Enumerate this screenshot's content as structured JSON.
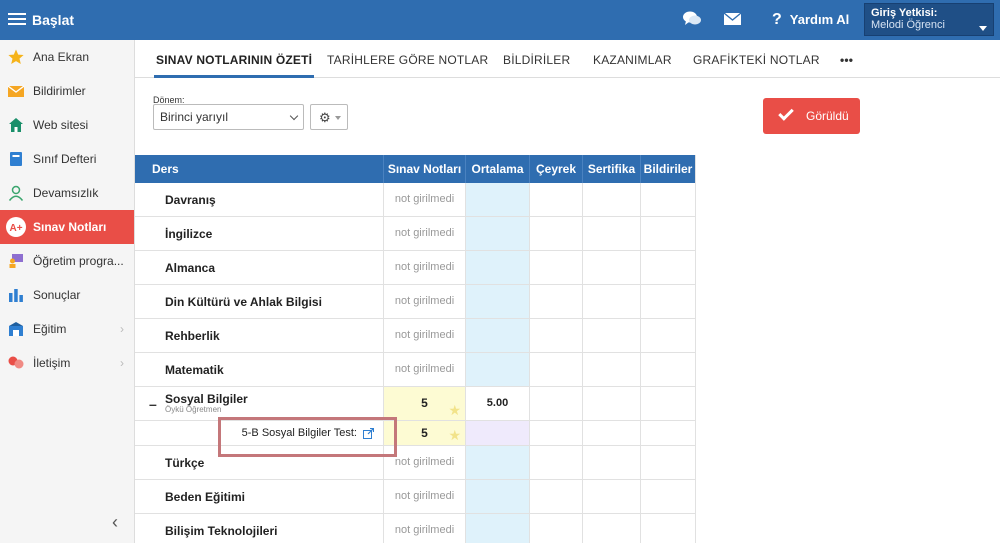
{
  "topbar": {
    "title": "Başlat",
    "help_label": "Yardım Al",
    "auth_title": "Giriş Yetkisi:",
    "auth_user": "Melodi Öğrenci"
  },
  "sidebar": {
    "items": [
      {
        "label": "Ana Ekran",
        "icon": "star-icon"
      },
      {
        "label": "Bildirimler",
        "icon": "envelope-icon"
      },
      {
        "label": "Web sitesi",
        "icon": "home-icon"
      },
      {
        "label": "Sınıf Defteri",
        "icon": "notebook-icon"
      },
      {
        "label": "Devamsızlık",
        "icon": "person-icon"
      },
      {
        "label": "Sınav Notları",
        "icon": "exam-icon",
        "active": true
      },
      {
        "label": "Öğretim progra...",
        "icon": "teacher-icon"
      },
      {
        "label": "Sonuçlar",
        "icon": "bar-chart-icon"
      },
      {
        "label": "Eğitim",
        "icon": "graduation-icon"
      },
      {
        "label": "İletişim",
        "icon": "chat-people-icon"
      }
    ]
  },
  "tabs": [
    {
      "label": "SINAV NOTLARININ ÖZETİ",
      "active": true
    },
    {
      "label": "TARİHLERE GÖRE NOTLAR"
    },
    {
      "label": "BİLDİRİLER"
    },
    {
      "label": "KAZANIMLAR"
    },
    {
      "label": "GRAFİKTEKİ NOTLAR"
    },
    {
      "label": "•••"
    }
  ],
  "filter": {
    "label": "Dönem:",
    "selected": "Birinci yarıyıl"
  },
  "seen_button": "Görüldü",
  "table": {
    "headers": [
      "Ders",
      "Sınav Notları",
      "Ortalama",
      "Çeyrek",
      "Sertifika",
      "Bildiriler"
    ],
    "rows": [
      {
        "subject": "Davranış",
        "status": "not girilmedi"
      },
      {
        "subject": "İngilizce",
        "status": "not girilmedi"
      },
      {
        "subject": "Almanca",
        "status": "not girilmedi"
      },
      {
        "subject": "Din Kültürü ve Ahlak Bilgisi",
        "status": "not girilmedi"
      },
      {
        "subject": "Rehberlik",
        "status": "not girilmedi"
      },
      {
        "subject": "Matematik",
        "status": "not girilmedi"
      }
    ],
    "expanded": {
      "collapse_symbol": "–",
      "subject": "Sosyal Bilgiler",
      "teacher": "Öykü Öğretmen",
      "grade": "5",
      "average": "5.00",
      "test_label": "5-B Sosyal Bilgiler Test:",
      "test_grade": "5"
    },
    "rows_after": [
      {
        "subject": "Türkçe",
        "status": "not girilmedi"
      },
      {
        "subject": "Beden Eğitimi",
        "status": "not girilmedi"
      },
      {
        "subject": "Bilişim Teknolojileri",
        "status": "not girilmedi"
      }
    ]
  },
  "colors": {
    "primary": "#2f6db0",
    "accent": "#e94e47",
    "avg_column": "#dff2fb",
    "grade_highlight": "#fdfbd3"
  }
}
